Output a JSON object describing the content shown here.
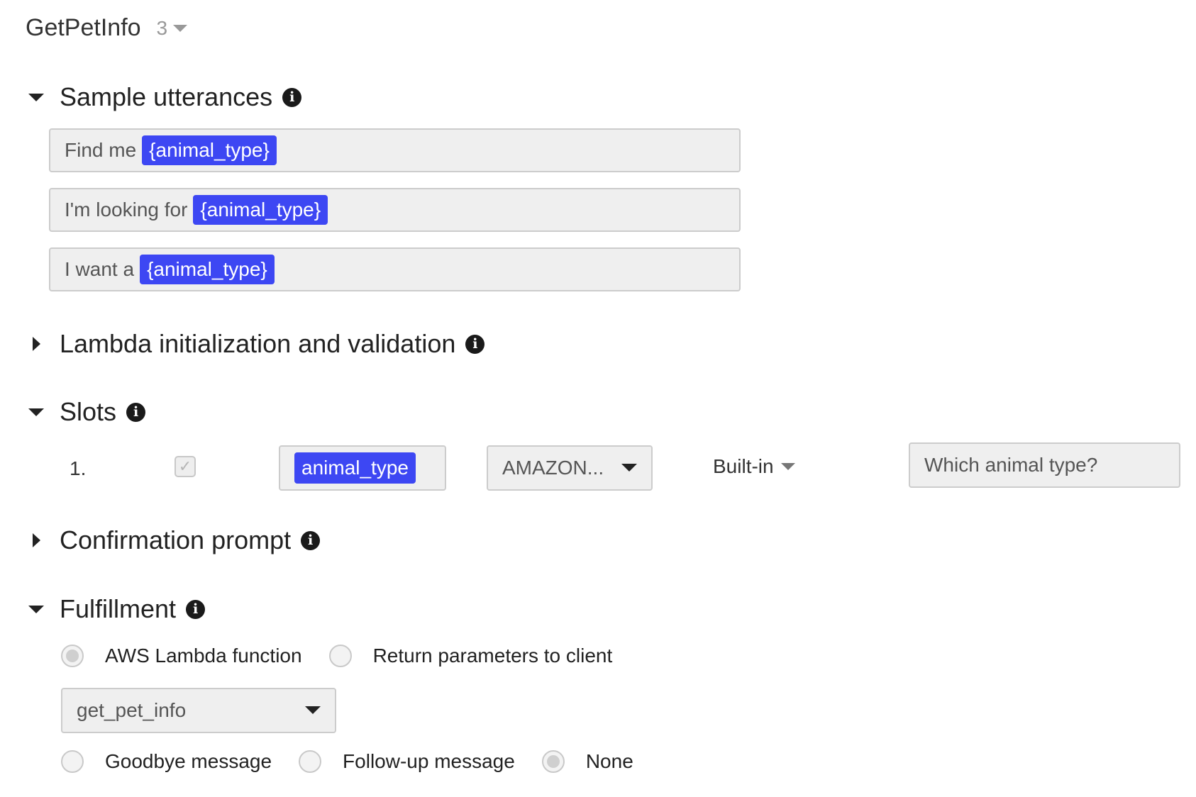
{
  "intent": {
    "name": "GetPetInfo",
    "version": "3"
  },
  "sections": {
    "sample_utterances": {
      "title": "Sample utterances",
      "expanded": true
    },
    "lambda_init": {
      "title": "Lambda initialization and validation",
      "expanded": false
    },
    "slots": {
      "title": "Slots",
      "expanded": true
    },
    "confirmation": {
      "title": "Confirmation prompt",
      "expanded": false
    },
    "fulfillment": {
      "title": "Fulfillment",
      "expanded": true
    }
  },
  "utterances": [
    {
      "text": "Find me",
      "slot": "{animal_type}"
    },
    {
      "text": "I'm looking for",
      "slot": "{animal_type}"
    },
    {
      "text": "I want a",
      "slot": "{animal_type}"
    }
  ],
  "slot_rows": [
    {
      "index": "1.",
      "required": true,
      "name": "animal_type",
      "type": "AMAZON...",
      "version": "Built-in",
      "prompt": "Which animal type?"
    }
  ],
  "fulfillment": {
    "options": [
      "AWS Lambda function",
      "Return parameters to client"
    ],
    "selected_option": "AWS Lambda function",
    "lambda_function": "get_pet_info",
    "response_options": [
      "Goodbye message",
      "Follow-up message",
      "None"
    ],
    "selected_response": "None"
  },
  "icons": {
    "info": "info-icon",
    "check": "check-icon"
  },
  "colors": {
    "slot_chip": "#3d47f3",
    "field_bg": "#efefef",
    "field_border": "#cccccc"
  }
}
